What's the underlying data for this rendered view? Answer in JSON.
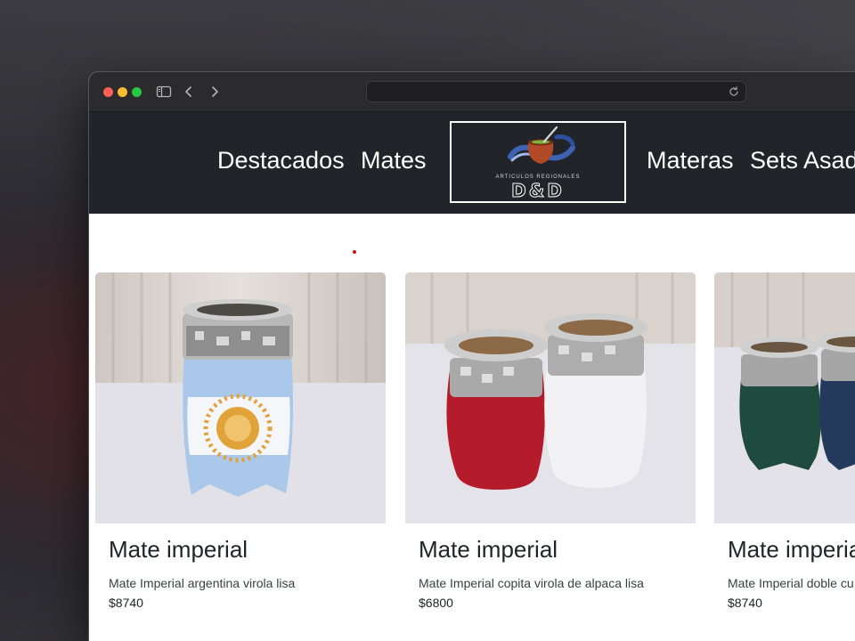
{
  "browser": {
    "address_value": "",
    "icons": [
      "sidebar-icon",
      "chevron-left-icon",
      "chevron-right-icon",
      "reload-icon"
    ],
    "traffic_lights": {
      "close": "#fe5f57",
      "minimize": "#febc2e",
      "zoom": "#28c840"
    }
  },
  "header": {
    "background": "#212529",
    "nav_left": [
      "Destacados",
      "Mates"
    ],
    "nav_right": [
      "Materas",
      "Sets Asad"
    ],
    "logo": {
      "subtitle": "ARTICULOS REGIONALES",
      "name": "D&D"
    }
  },
  "products": [
    {
      "title": "Mate imperial",
      "description": "Mate Imperial argentina virola lisa",
      "price": "$8740"
    },
    {
      "title": "Mate imperial",
      "description": "Mate Imperial copita virola de alpaca lisa",
      "price": "$6800"
    },
    {
      "title": "Mate imperia",
      "description": "Mate Imperial doble cu alpaca lisa",
      "price": "$8740"
    }
  ]
}
